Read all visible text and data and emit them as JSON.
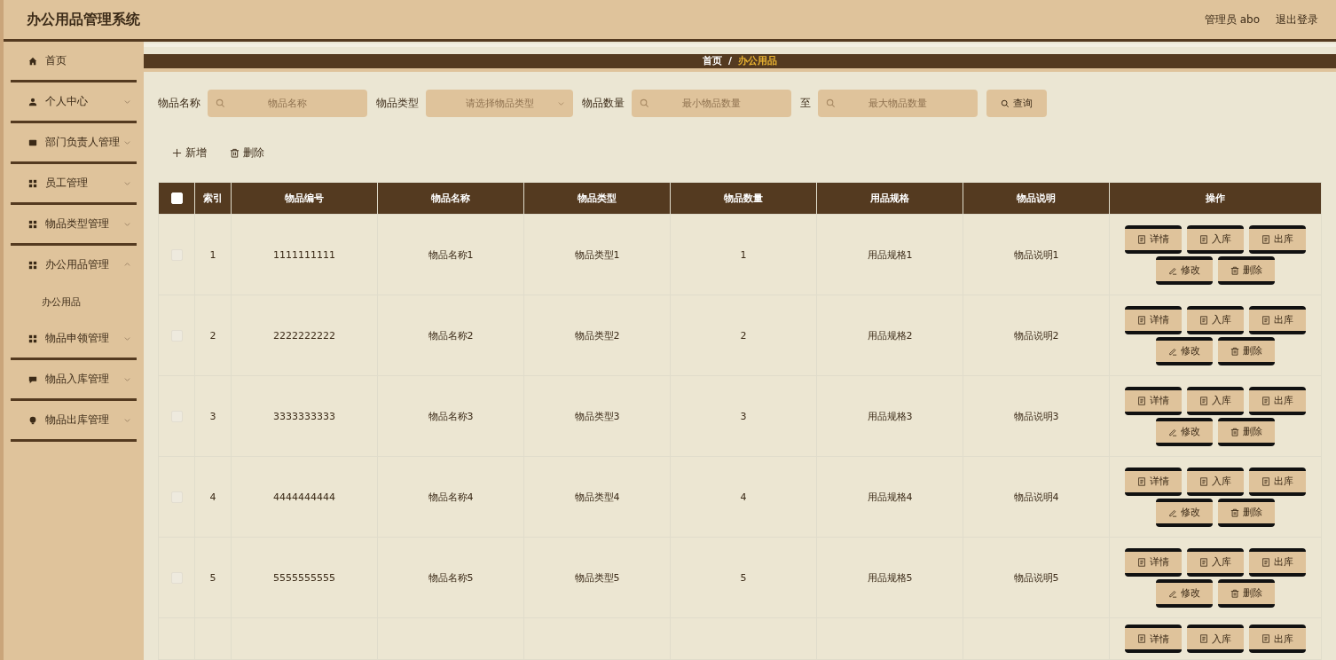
{
  "header": {
    "title": "办公用品管理系统",
    "user": "管理员 abo",
    "logout": "退出登录"
  },
  "sidebar": {
    "items": [
      {
        "label": "首页"
      },
      {
        "label": "个人中心",
        "expanded": false
      },
      {
        "label": "部门负责人管理",
        "expanded": false
      },
      {
        "label": "员工管理",
        "expanded": false
      },
      {
        "label": "物品类型管理",
        "expanded": false
      },
      {
        "label": "办公用品管理",
        "expanded": true,
        "children": [
          {
            "label": "办公用品"
          }
        ]
      },
      {
        "label": "物品申领管理",
        "expanded": false
      },
      {
        "label": "物品入库管理",
        "expanded": false
      },
      {
        "label": "物品出库管理",
        "expanded": false
      }
    ]
  },
  "breadcrumb": {
    "home": "首页",
    "separator": "/",
    "current": "办公用品"
  },
  "search": {
    "fields": [
      {
        "kind": "input",
        "label": "物品名称",
        "placeholder": "物品名称"
      },
      {
        "kind": "select",
        "label": "物品类型",
        "placeholder": "请选择物品类型"
      },
      {
        "kind": "input",
        "label": "物品数量",
        "placeholder": "最小物品数量"
      },
      {
        "kind": "input",
        "label": "至",
        "placeholder": "最大物品数量"
      }
    ],
    "button": "查询"
  },
  "toolbar": {
    "add": "新增",
    "delete": "删除"
  },
  "table": {
    "select_all_checked": false,
    "columns": [
      "索引",
      "物品编号",
      "物品名称",
      "物品类型",
      "物品数量",
      "用品规格",
      "物品说明",
      "操作"
    ],
    "rows": [
      {
        "checked": false,
        "cells": [
          "1",
          "1111111111",
          "物品名称1",
          "物品类型1",
          "1",
          "用品规格1",
          "物品说明1"
        ],
        "actions": [
          "详情",
          "入库",
          "出库",
          "修改",
          "删除"
        ]
      },
      {
        "checked": false,
        "cells": [
          "2",
          "2222222222",
          "物品名称2",
          "物品类型2",
          "2",
          "用品规格2",
          "物品说明2"
        ],
        "actions": [
          "详情",
          "入库",
          "出库",
          "修改",
          "删除"
        ]
      },
      {
        "checked": false,
        "cells": [
          "3",
          "3333333333",
          "物品名称3",
          "物品类型3",
          "3",
          "用品规格3",
          "物品说明3"
        ],
        "actions": [
          "详情",
          "入库",
          "出库",
          "修改",
          "删除"
        ]
      },
      {
        "checked": false,
        "cells": [
          "4",
          "4444444444",
          "物品名称4",
          "物品类型4",
          "4",
          "用品规格4",
          "物品说明4"
        ],
        "actions": [
          "详情",
          "入库",
          "出库",
          "修改",
          "删除"
        ]
      },
      {
        "checked": false,
        "cells": [
          "5",
          "5555555555",
          "物品名称5",
          "物品类型5",
          "5",
          "用品规格5",
          "物品说明5"
        ],
        "actions": [
          "详情",
          "入库",
          "出库",
          "修改",
          "删除"
        ]
      },
      {
        "cells": [],
        "actions": [
          "详情",
          "入库",
          "出库"
        ]
      }
    ]
  }
}
